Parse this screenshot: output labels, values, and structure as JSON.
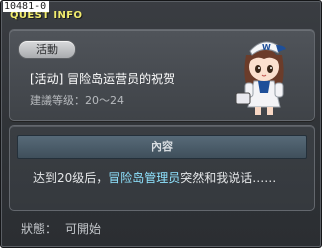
{
  "window": {
    "quest_id": "10481-0",
    "title": "QUEST INFO"
  },
  "quest": {
    "tag": "活動",
    "name": "[活动] 冒险岛运营员的祝贺",
    "level": "建議等级：20～24",
    "npc_icon": "npc-girl-portrait"
  },
  "content": {
    "header": "內容",
    "text_before": "达到20级后，",
    "npc_name": "冒险岛管理员",
    "text_after": "突然和我说话……"
  },
  "status": {
    "label": "狀態：",
    "value": "可開始"
  },
  "colors": {
    "title": "#f1ec6e",
    "highlight": "#8fe3ff",
    "panel": "#464a50",
    "content_header": "#4b5d6a"
  }
}
